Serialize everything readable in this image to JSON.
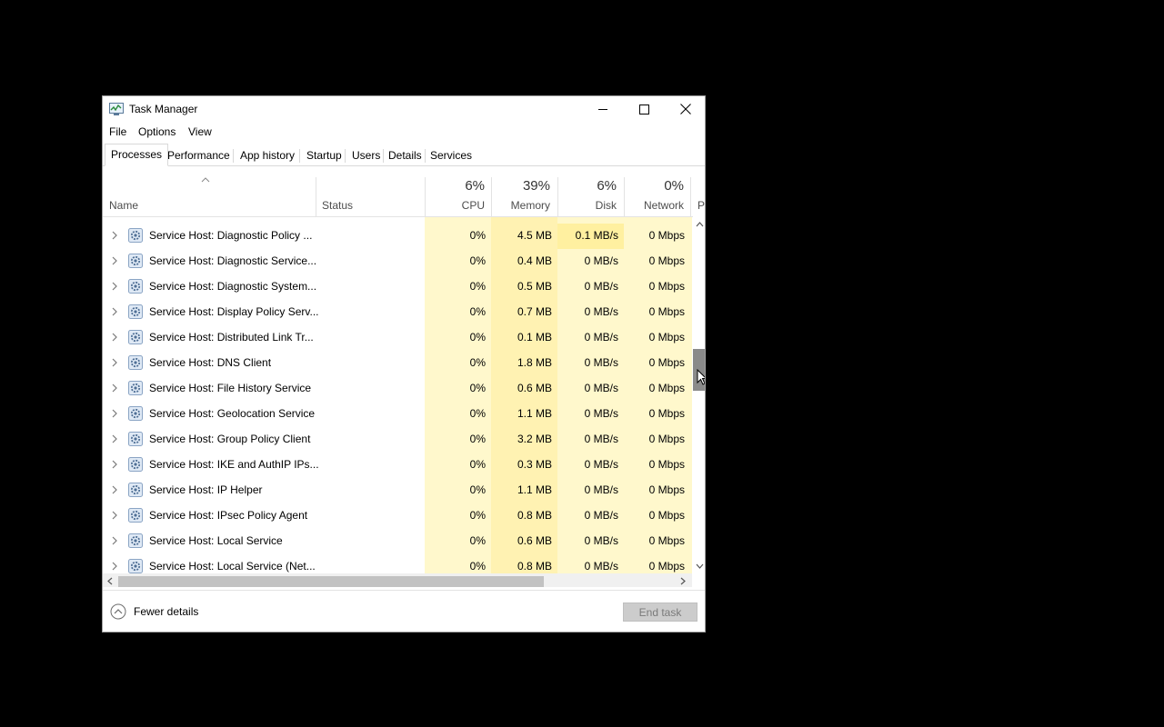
{
  "window": {
    "title": "Task Manager"
  },
  "menu": [
    "File",
    "Options",
    "View"
  ],
  "tabs": [
    "Processes",
    "Performance",
    "App history",
    "Startup",
    "Users",
    "Details",
    "Services"
  ],
  "active_tab": "Processes",
  "columns": {
    "name": "Name",
    "status": "Status",
    "cpu": {
      "label": "CPU",
      "percent": "6%"
    },
    "memory": {
      "label": "Memory",
      "percent": "39%"
    },
    "disk": {
      "label": "Disk",
      "percent": "6%"
    },
    "network": {
      "label": "Network",
      "percent": "0%"
    },
    "power_partial": "P"
  },
  "processes": [
    {
      "name": "Service Host: Diagnostic Policy ...",
      "status": "",
      "cpu": "0%",
      "memory": "4.5 MB",
      "disk": "0.1 MB/s",
      "network": "0 Mbps"
    },
    {
      "name": "Service Host: Diagnostic Service...",
      "status": "",
      "cpu": "0%",
      "memory": "0.4 MB",
      "disk": "0 MB/s",
      "network": "0 Mbps"
    },
    {
      "name": "Service Host: Diagnostic System...",
      "status": "",
      "cpu": "0%",
      "memory": "0.5 MB",
      "disk": "0 MB/s",
      "network": "0 Mbps"
    },
    {
      "name": "Service Host: Display Policy Serv...",
      "status": "",
      "cpu": "0%",
      "memory": "0.7 MB",
      "disk": "0 MB/s",
      "network": "0 Mbps"
    },
    {
      "name": "Service Host: Distributed Link Tr...",
      "status": "",
      "cpu": "0%",
      "memory": "0.1 MB",
      "disk": "0 MB/s",
      "network": "0 Mbps"
    },
    {
      "name": "Service Host: DNS Client",
      "status": "",
      "cpu": "0%",
      "memory": "1.8 MB",
      "disk": "0 MB/s",
      "network": "0 Mbps"
    },
    {
      "name": "Service Host: File History Service",
      "status": "",
      "cpu": "0%",
      "memory": "0.6 MB",
      "disk": "0 MB/s",
      "network": "0 Mbps"
    },
    {
      "name": "Service Host: Geolocation Service",
      "status": "",
      "cpu": "0%",
      "memory": "1.1 MB",
      "disk": "0 MB/s",
      "network": "0 Mbps"
    },
    {
      "name": "Service Host: Group Policy Client",
      "status": "",
      "cpu": "0%",
      "memory": "3.2 MB",
      "disk": "0 MB/s",
      "network": "0 Mbps"
    },
    {
      "name": "Service Host: IKE and AuthIP IPs...",
      "status": "",
      "cpu": "0%",
      "memory": "0.3 MB",
      "disk": "0 MB/s",
      "network": "0 Mbps"
    },
    {
      "name": "Service Host: IP Helper",
      "status": "",
      "cpu": "0%",
      "memory": "1.1 MB",
      "disk": "0 MB/s",
      "network": "0 Mbps"
    },
    {
      "name": "Service Host: IPsec Policy Agent",
      "status": "",
      "cpu": "0%",
      "memory": "0.8 MB",
      "disk": "0 MB/s",
      "network": "0 Mbps"
    },
    {
      "name": "Service Host: Local Service",
      "status": "",
      "cpu": "0%",
      "memory": "0.6 MB",
      "disk": "0 MB/s",
      "network": "0 Mbps"
    },
    {
      "name": "Service Host: Local Service (Net...",
      "status": "",
      "cpu": "0%",
      "memory": "0.8 MB",
      "disk": "0 MB/s",
      "network": "0 Mbps"
    }
  ],
  "footer": {
    "fewer_details": "Fewer details",
    "end_task": "End task"
  },
  "colors": {
    "cpu_bg": "#fff8cc",
    "memory_bg": "#fff2b2",
    "disk_bg": "#fff8cc",
    "disk_highlight": "#fff0a0",
    "network_bg": "#fff8cc"
  },
  "icons": {
    "app": "task-manager-icon",
    "process": "gear-icon",
    "expand": "chevron-right-icon"
  }
}
